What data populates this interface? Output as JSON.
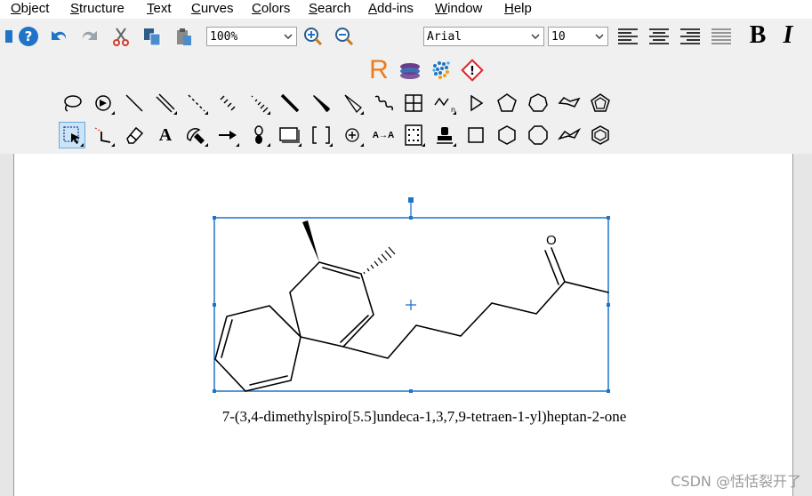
{
  "menu": {
    "items": [
      {
        "mnemonic": "O",
        "rest": "bject"
      },
      {
        "mnemonic": "S",
        "rest": "tructure"
      },
      {
        "mnemonic": "T",
        "rest": "ext"
      },
      {
        "mnemonic": "C",
        "rest": "urves"
      },
      {
        "mnemonic": "C",
        "rest": "olors"
      },
      {
        "mnemonic": "S",
        "rest": "earch"
      },
      {
        "mnemonic": "A",
        "rest": "dd-ins"
      },
      {
        "mnemonic": "W",
        "rest": "indow"
      },
      {
        "mnemonic": "H",
        "rest": "elp"
      }
    ]
  },
  "toolbar": {
    "zoom_value": "100%",
    "font_value": "Arial",
    "size_value": "10",
    "bold_label": "B",
    "italic_label": "I",
    "r_label": "R",
    "text_tool_label": "A",
    "arrow_text_label": "A→A"
  },
  "colors": {
    "accent_blue": "#1f74c8",
    "r_orange": "#f07a1a",
    "hazard_red": "#e0262b"
  },
  "document": {
    "caption": "7-(3,4-dimethylspiro[5.5]undeca-1,3,7,9-tetraen-1-yl)heptan-2-one",
    "oxygen_label": "O"
  },
  "watermark": "CSDN @恬恬裂开了"
}
